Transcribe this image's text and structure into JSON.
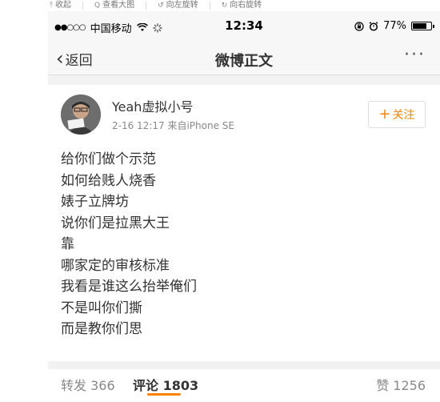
{
  "viewer_toolbar": {
    "items": [
      {
        "icon": "collapse-icon",
        "glyph": "⤒",
        "label": "收起"
      },
      {
        "icon": "magnifier-icon",
        "glyph": "Q",
        "label": "查看大图"
      },
      {
        "icon": "rotate-left-icon",
        "glyph": "↺",
        "label": "向左旋转"
      },
      {
        "icon": "rotate-right-icon",
        "glyph": "↻",
        "label": "向右旋转"
      }
    ]
  },
  "status_bar": {
    "signal": "●●○○○",
    "carrier": "中国移动",
    "wifi": "wifi-icon",
    "activity": "activity-spinner-icon",
    "time": "12:34",
    "lock": "orientation-lock-icon",
    "alarm": "alarm-icon",
    "battery_text": "77%",
    "battery_level": 0.77
  },
  "nav": {
    "back_label": "返回",
    "title": "微博正文",
    "more": "···"
  },
  "post": {
    "username": "Yeah虚拟小号",
    "meta": "2-16 12:17  来自iPhone SE",
    "follow_label": "关注",
    "lines": [
      "给你们做个示范",
      "如何给贱人烧香",
      "婊子立牌坊",
      "说你们是拉黑大王",
      "靠",
      "哪家定的审核标准",
      "我看是谁这么抬举俺们",
      "不是叫你们撕",
      "而是教你们思"
    ]
  },
  "tabs": {
    "repost": "转发 366",
    "comment": "评论 1803",
    "like": "赞 1256"
  },
  "colors": {
    "accent": "#ff8200",
    "background": "#f2f2f2"
  }
}
